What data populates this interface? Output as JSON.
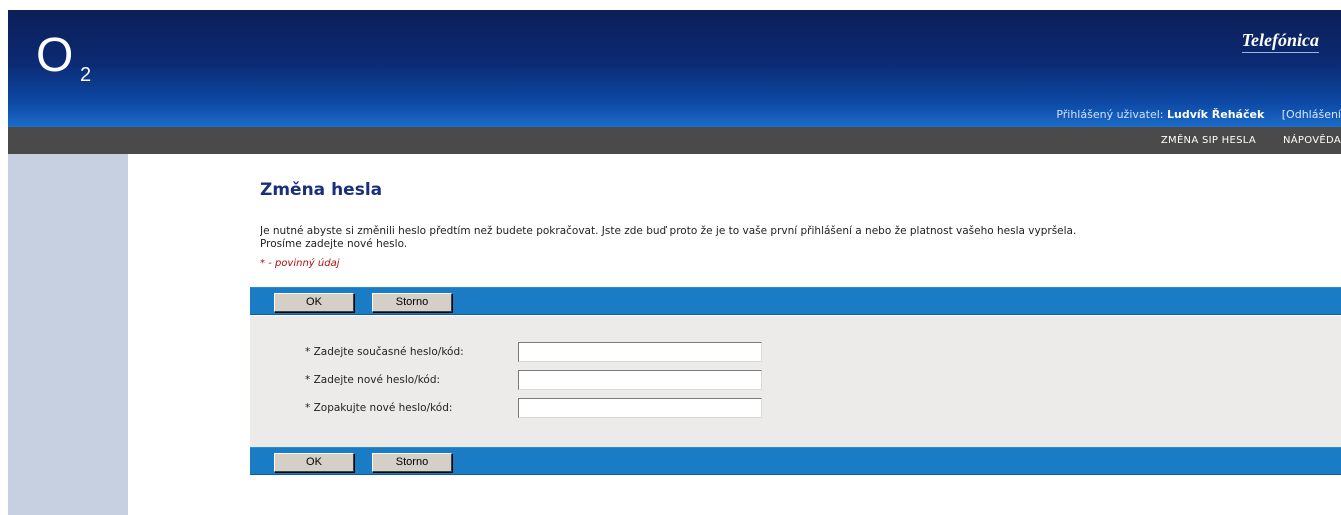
{
  "header": {
    "logo_letter": "O",
    "logo_sub": "2",
    "brand": "Telefónica",
    "user_label": "Přihlášený uživatel:",
    "user_name": "Ludvík Řeháček",
    "logout": "[Odhlášení"
  },
  "nav": {
    "items": [
      "ZMĚNA SIP HESLA",
      "NÁPOVĚDA"
    ]
  },
  "page": {
    "title": "Změna hesla",
    "intro_line1": "Je nutné abyste si změnili heslo předtím než budete pokračovat. Jste zde buď proto že je to vaše první přihlášení a nebo že platnost vašeho hesla vypršela.",
    "intro_line2": "Prosíme zadejte nové heslo.",
    "required_note": "* - povinný údaj"
  },
  "buttons": {
    "ok": "OK",
    "cancel": "Storno"
  },
  "form": {
    "fields": [
      {
        "label": "* Zadejte současné heslo/kód:",
        "value": ""
      },
      {
        "label": "* Zadejte nové heslo/kód:",
        "value": ""
      },
      {
        "label": "* Zopakujte nové heslo/kód:",
        "value": ""
      }
    ]
  },
  "colors": {
    "header_dark": "#0c1f58",
    "header_light": "#1b6cc9",
    "navbar": "#4a4a4a",
    "sidebar": "#c6d0e0",
    "buttonbar": "#1a7cc4",
    "title": "#1a2f7a",
    "required": "#b01010"
  }
}
